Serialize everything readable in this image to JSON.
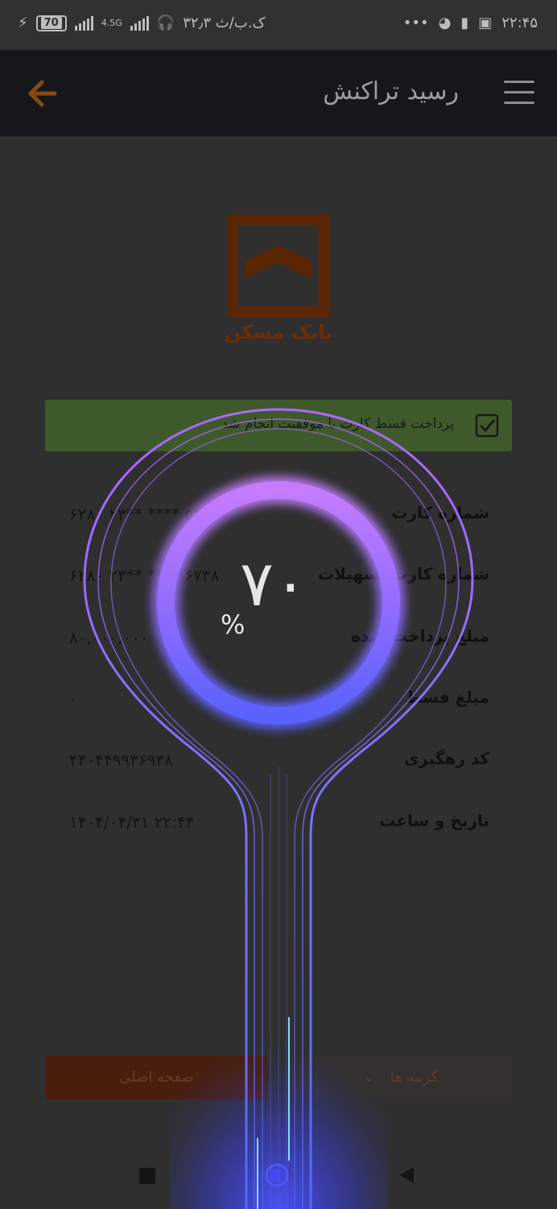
{
  "status_bar": {
    "time": "۲۲:۴۵",
    "battery": "70",
    "network": "4.5G",
    "speed": "۳۲٫۳ ک.ب/ث",
    "dots": "•••"
  },
  "app_bar": {
    "title": "رسید تراکنش"
  },
  "bank": {
    "name": "بانک مسکن",
    "logo_color": "#6a2d05"
  },
  "banner": {
    "message": "پرداخت قسط کارت با موفقیت انجام شد"
  },
  "details": [
    {
      "label": "شماره کارت",
      "value": "۶۲۸۰ ۲۳** **** ۵۳۲۷"
    },
    {
      "label": "شماره کارت تسهیلات",
      "value": "۶۲۸۰ ۲۳** **** ۶۷۳۸"
    },
    {
      "label": "مبلغ پرداخت شده",
      "value": "۸۰,۰۰۰,۰۰۰"
    },
    {
      "label": "مبلغ قسط",
      "value": "۰"
    },
    {
      "label": "کد رهگیری",
      "value": "۴۴۰۴۴۹۹۳۶۹۳۸"
    },
    {
      "label": "تاریخ و ساعت",
      "value": "۱۴۰۴/۰۴/۳۱ ۲۲:۴۴"
    }
  ],
  "buttons": {
    "main_page": "صفحه اصلی",
    "options": "گزینه ها"
  },
  "charging_overlay": {
    "percent_value": 70,
    "percent_text": "۷۰",
    "percent_sign": "%"
  },
  "colors": {
    "accent_orange": "#e07a1a",
    "app_bar": "#16171b",
    "success_green": "#3e5a2a",
    "ring_purple": "#b46cff",
    "ring_blue": "#5a6cff"
  }
}
